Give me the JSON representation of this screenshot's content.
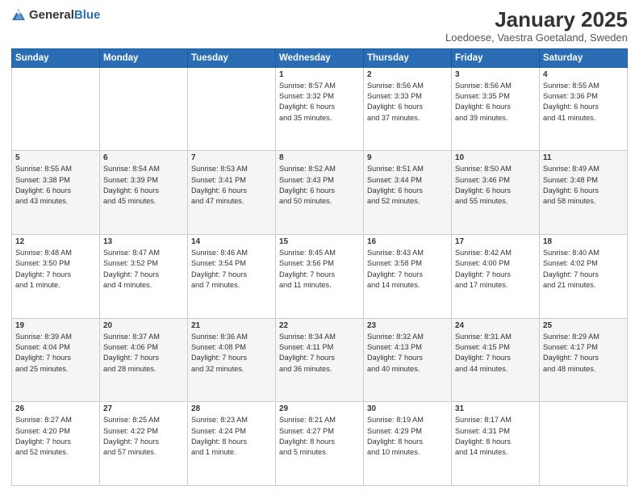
{
  "header": {
    "logo_general": "General",
    "logo_blue": "Blue",
    "title": "January 2025",
    "subtitle": "Loedoese, Vaestra Goetaland, Sweden"
  },
  "days_of_week": [
    "Sunday",
    "Monday",
    "Tuesday",
    "Wednesday",
    "Thursday",
    "Friday",
    "Saturday"
  ],
  "weeks": [
    [
      {
        "day": "",
        "info": ""
      },
      {
        "day": "",
        "info": ""
      },
      {
        "day": "",
        "info": ""
      },
      {
        "day": "1",
        "info": "Sunrise: 8:57 AM\nSunset: 3:32 PM\nDaylight: 6 hours\nand 35 minutes."
      },
      {
        "day": "2",
        "info": "Sunrise: 8:56 AM\nSunset: 3:33 PM\nDaylight: 6 hours\nand 37 minutes."
      },
      {
        "day": "3",
        "info": "Sunrise: 8:56 AM\nSunset: 3:35 PM\nDaylight: 6 hours\nand 39 minutes."
      },
      {
        "day": "4",
        "info": "Sunrise: 8:55 AM\nSunset: 3:36 PM\nDaylight: 6 hours\nand 41 minutes."
      }
    ],
    [
      {
        "day": "5",
        "info": "Sunrise: 8:55 AM\nSunset: 3:38 PM\nDaylight: 6 hours\nand 43 minutes."
      },
      {
        "day": "6",
        "info": "Sunrise: 8:54 AM\nSunset: 3:39 PM\nDaylight: 6 hours\nand 45 minutes."
      },
      {
        "day": "7",
        "info": "Sunrise: 8:53 AM\nSunset: 3:41 PM\nDaylight: 6 hours\nand 47 minutes."
      },
      {
        "day": "8",
        "info": "Sunrise: 8:52 AM\nSunset: 3:43 PM\nDaylight: 6 hours\nand 50 minutes."
      },
      {
        "day": "9",
        "info": "Sunrise: 8:51 AM\nSunset: 3:44 PM\nDaylight: 6 hours\nand 52 minutes."
      },
      {
        "day": "10",
        "info": "Sunrise: 8:50 AM\nSunset: 3:46 PM\nDaylight: 6 hours\nand 55 minutes."
      },
      {
        "day": "11",
        "info": "Sunrise: 8:49 AM\nSunset: 3:48 PM\nDaylight: 6 hours\nand 58 minutes."
      }
    ],
    [
      {
        "day": "12",
        "info": "Sunrise: 8:48 AM\nSunset: 3:50 PM\nDaylight: 7 hours\nand 1 minute."
      },
      {
        "day": "13",
        "info": "Sunrise: 8:47 AM\nSunset: 3:52 PM\nDaylight: 7 hours\nand 4 minutes."
      },
      {
        "day": "14",
        "info": "Sunrise: 8:46 AM\nSunset: 3:54 PM\nDaylight: 7 hours\nand 7 minutes."
      },
      {
        "day": "15",
        "info": "Sunrise: 8:45 AM\nSunset: 3:56 PM\nDaylight: 7 hours\nand 11 minutes."
      },
      {
        "day": "16",
        "info": "Sunrise: 8:43 AM\nSunset: 3:58 PM\nDaylight: 7 hours\nand 14 minutes."
      },
      {
        "day": "17",
        "info": "Sunrise: 8:42 AM\nSunset: 4:00 PM\nDaylight: 7 hours\nand 17 minutes."
      },
      {
        "day": "18",
        "info": "Sunrise: 8:40 AM\nSunset: 4:02 PM\nDaylight: 7 hours\nand 21 minutes."
      }
    ],
    [
      {
        "day": "19",
        "info": "Sunrise: 8:39 AM\nSunset: 4:04 PM\nDaylight: 7 hours\nand 25 minutes."
      },
      {
        "day": "20",
        "info": "Sunrise: 8:37 AM\nSunset: 4:06 PM\nDaylight: 7 hours\nand 28 minutes."
      },
      {
        "day": "21",
        "info": "Sunrise: 8:36 AM\nSunset: 4:08 PM\nDaylight: 7 hours\nand 32 minutes."
      },
      {
        "day": "22",
        "info": "Sunrise: 8:34 AM\nSunset: 4:11 PM\nDaylight: 7 hours\nand 36 minutes."
      },
      {
        "day": "23",
        "info": "Sunrise: 8:32 AM\nSunset: 4:13 PM\nDaylight: 7 hours\nand 40 minutes."
      },
      {
        "day": "24",
        "info": "Sunrise: 8:31 AM\nSunset: 4:15 PM\nDaylight: 7 hours\nand 44 minutes."
      },
      {
        "day": "25",
        "info": "Sunrise: 8:29 AM\nSunset: 4:17 PM\nDaylight: 7 hours\nand 48 minutes."
      }
    ],
    [
      {
        "day": "26",
        "info": "Sunrise: 8:27 AM\nSunset: 4:20 PM\nDaylight: 7 hours\nand 52 minutes."
      },
      {
        "day": "27",
        "info": "Sunrise: 8:25 AM\nSunset: 4:22 PM\nDaylight: 7 hours\nand 57 minutes."
      },
      {
        "day": "28",
        "info": "Sunrise: 8:23 AM\nSunset: 4:24 PM\nDaylight: 8 hours\nand 1 minute."
      },
      {
        "day": "29",
        "info": "Sunrise: 8:21 AM\nSunset: 4:27 PM\nDaylight: 8 hours\nand 5 minutes."
      },
      {
        "day": "30",
        "info": "Sunrise: 8:19 AM\nSunset: 4:29 PM\nDaylight: 8 hours\nand 10 minutes."
      },
      {
        "day": "31",
        "info": "Sunrise: 8:17 AM\nSunset: 4:31 PM\nDaylight: 8 hours\nand 14 minutes."
      },
      {
        "day": "",
        "info": ""
      }
    ]
  ]
}
